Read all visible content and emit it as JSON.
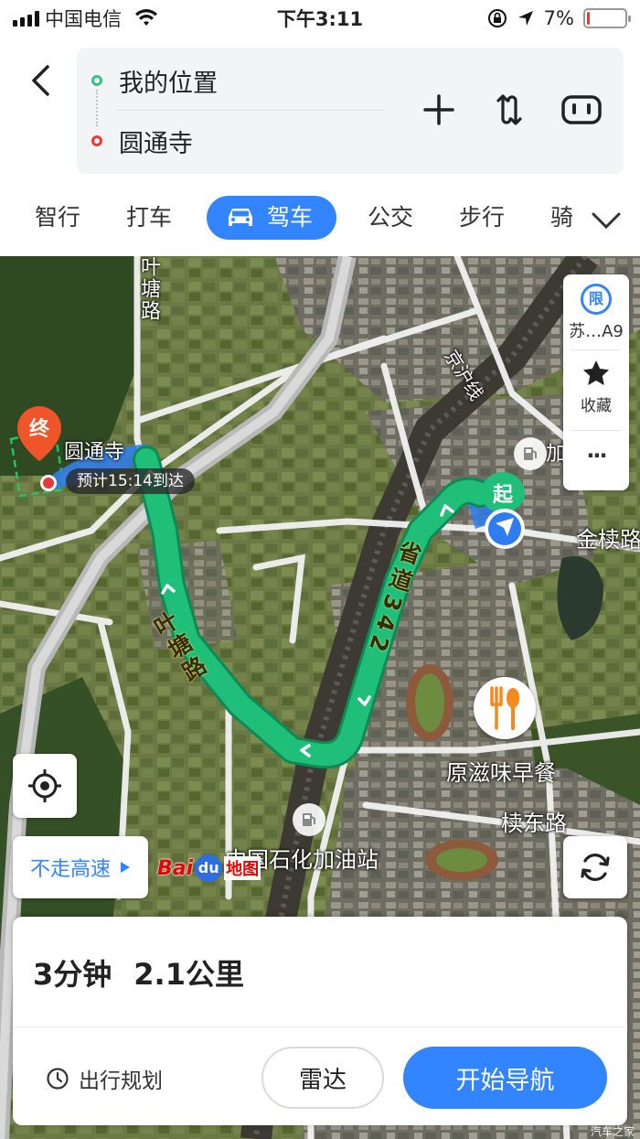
{
  "status_bar": {
    "carrier": "中国电信",
    "time": "下午3:11",
    "battery_text": "7%",
    "battery_level": 0.07
  },
  "route": {
    "origin": "我的位置",
    "destination": "圆通寺"
  },
  "header_icons": [
    "back-icon",
    "add-icon",
    "swap-icon",
    "route-options-icon"
  ],
  "tabs": [
    {
      "label": "智行"
    },
    {
      "label": "打车"
    },
    {
      "label": "驾车"
    },
    {
      "label": "公交"
    },
    {
      "label": "步行"
    },
    {
      "label": "骑"
    }
  ],
  "active_tab": "驾车",
  "map": {
    "pins": {
      "end_label": "终",
      "start_label": "起"
    },
    "eta_pill": "预计15:14到达",
    "place_labels": {
      "temple": "圆通寺",
      "gas_poi_short": "加",
      "jinlu": "金椟路",
      "breakfast": "原滋味早餐",
      "dudong": "椟东路",
      "sinopec": "中国石化加油站",
      "railway": "京沪线"
    },
    "road_labels": {
      "yetang_top": "叶塘路",
      "yetang_mid": "叶塘路",
      "provincial": "省道342"
    },
    "route_color": "#1fbf7a",
    "logo": {
      "bai": "Bai",
      "paw": "du",
      "map_word": "地图"
    }
  },
  "side_panel": {
    "limit_icon_text": "限",
    "limit_text": "苏…A9",
    "favorite_label": "收藏",
    "more_label": "···"
  },
  "buttons": {
    "avoid_highway": "不走高速"
  },
  "summary": {
    "duration": "3分钟",
    "distance": "2.1公里",
    "plan_label": "出行规划",
    "radar_label": "雷达",
    "start_nav_label": "开始导航"
  },
  "watermark": "汽车之家"
}
